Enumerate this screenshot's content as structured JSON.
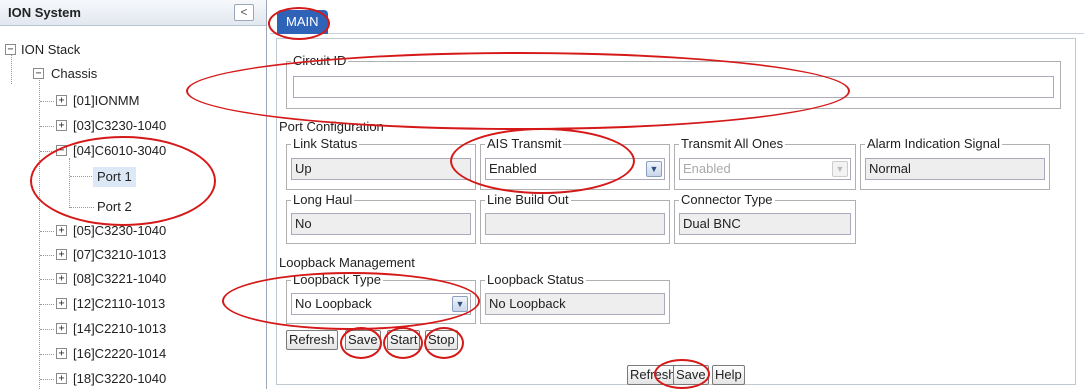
{
  "tree": {
    "title": "ION System",
    "collapse_icon": "<",
    "nodes": {
      "stack": "ION Stack",
      "chassis": "Chassis",
      "m01": "[01]IONMM",
      "m03": "[03]C3230-1040",
      "m04": "[04]C6010-3040",
      "port1": "Port 1",
      "port2": "Port 2",
      "m05": "[05]C3230-1040",
      "m07": "[07]C3210-1013",
      "m08": "[08]C3221-1040",
      "m12": "[12]C2110-1013",
      "m14": "[14]C2210-1013",
      "m16": "[16]C2220-1014",
      "m18": "[18]C3220-1040"
    },
    "expand_glyph": "+",
    "collapse_glyph": "−"
  },
  "tabs": {
    "main": "MAIN"
  },
  "circuit": {
    "label": "Circuit ID",
    "value": ""
  },
  "port_config": {
    "title": "Port Configuration",
    "link_status": {
      "label": "Link Status",
      "value": "Up"
    },
    "ais_transmit": {
      "label": "AIS Transmit",
      "value": "Enabled"
    },
    "transmit_all_ones": {
      "label": "Transmit All Ones",
      "value": "Enabled"
    },
    "alarm_indication": {
      "label": "Alarm Indication Signal",
      "value": "Normal"
    },
    "long_haul": {
      "label": "Long Haul",
      "value": "No"
    },
    "line_build_out": {
      "label": "Line Build Out",
      "value": ""
    },
    "connector_type": {
      "label": "Connector Type",
      "value": "Dual BNC"
    }
  },
  "loopback": {
    "title": "Loopback Management",
    "type": {
      "label": "Loopback Type",
      "value": "No Loopback"
    },
    "status": {
      "label": "Loopback Status",
      "value": "No Loopback"
    },
    "buttons": {
      "refresh": "Refresh",
      "save": "Save",
      "start": "Start",
      "stop": "Stop"
    }
  },
  "footer": {
    "refresh": "Refresh",
    "save": "Save",
    "help": "Help"
  },
  "colors": {
    "tab": "#2f63b8",
    "annotation": "#d51818",
    "selected": "#dce8f6"
  }
}
